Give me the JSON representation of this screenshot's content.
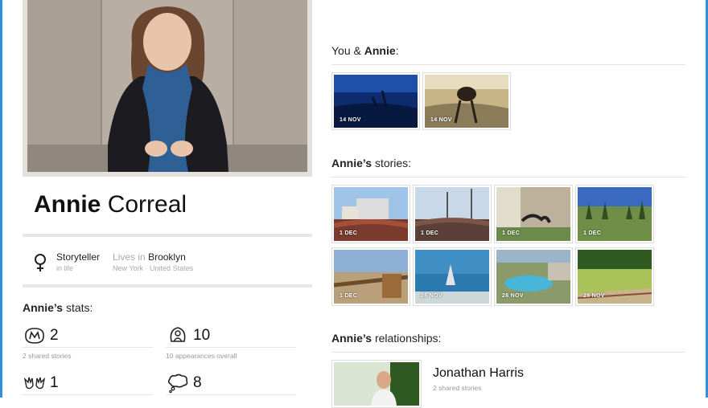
{
  "profile": {
    "first_name": "Annie",
    "last_name": "Correal",
    "role": "Storyteller",
    "role_sub": "in life",
    "lives_label": "Lives in",
    "city": "Brooklyn",
    "location_sub": "New York · United States"
  },
  "stats": {
    "heading_name": "Annie’s",
    "heading_rest": "stats:",
    "items": [
      {
        "icon": "shared-stories-icon",
        "value": "2",
        "label": "2 shared stories"
      },
      {
        "icon": "appearances-icon",
        "value": "10",
        "label": "10 appearances overall"
      },
      {
        "icon": "hands-icon",
        "value": "1",
        "label": ""
      },
      {
        "icon": "thought-bubble-icon",
        "value": "8",
        "label": ""
      }
    ]
  },
  "you_and": {
    "prefix": "You &",
    "name": "Annie",
    "suffix": ":",
    "thumbs": [
      {
        "date": "14 NOV"
      },
      {
        "date": "14 NOV"
      }
    ]
  },
  "stories": {
    "name": "Annie’s",
    "rest": "stories:",
    "thumbs": [
      {
        "date": "1 DEC"
      },
      {
        "date": "1 DEC"
      },
      {
        "date": "1 DEC"
      },
      {
        "date": "1 DEC"
      },
      {
        "date": "1 DEC"
      },
      {
        "date": "26 NOV"
      },
      {
        "date": "26 NOV"
      },
      {
        "date": "26 NOV"
      }
    ]
  },
  "relationships": {
    "name": "Annie’s",
    "rest": "relationships:",
    "items": [
      {
        "name": "Jonathan Harris",
        "sub": "2 shared stories"
      }
    ]
  },
  "colors": {
    "frame": "#2f8fe0",
    "rule": "#e6e6e6",
    "muted": "#aaaaaa"
  }
}
